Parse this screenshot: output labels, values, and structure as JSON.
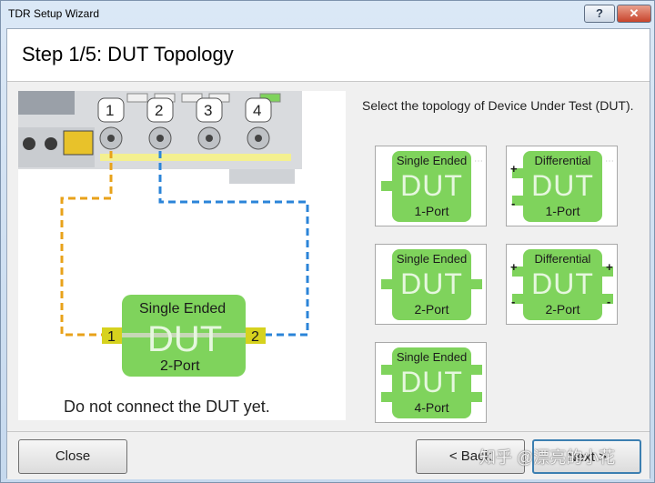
{
  "window": {
    "title": "TDR Setup Wizard",
    "help_label": "?",
    "close_label": "✕"
  },
  "header": {
    "step_title": "Step 1/5: DUT Topology"
  },
  "illustration": {
    "port_numbers": [
      "1",
      "2",
      "3",
      "4"
    ],
    "dut": {
      "top": "Single Ended",
      "center": "DUT",
      "bottom": "2-Port",
      "left_port": "1",
      "right_port": "2"
    },
    "warning": "Do not connect the DUT yet."
  },
  "instruction": "Select the topology of Device Under Test (DUT).",
  "topologies": [
    {
      "top": "Single Ended",
      "center": "DUT",
      "bottom": "1-Port"
    },
    {
      "top": "Differential",
      "center": "DUT",
      "bottom": "1-Port"
    },
    {
      "top": "Single Ended",
      "center": "DUT",
      "bottom": "2-Port"
    },
    {
      "top": "Differential",
      "center": "DUT",
      "bottom": "2-Port"
    },
    {
      "top": "Single Ended",
      "center": "DUT",
      "bottom": "4-Port"
    }
  ],
  "footer": {
    "close_label": "Close",
    "back_label": "< Back",
    "next_label": "Next >",
    "watermark": "知乎 @漂亮的小花"
  },
  "colors": {
    "dut_green": "#7fd35c",
    "cable_orange": "#e8a21a",
    "cable_blue": "#2b84d8",
    "port_label_yellow": "#d6d21e"
  }
}
